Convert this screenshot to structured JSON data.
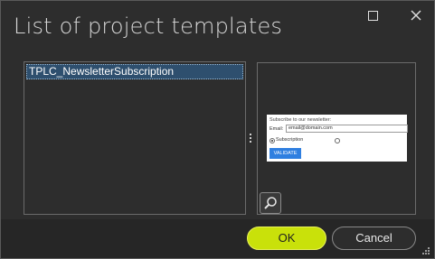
{
  "window": {
    "title": "List of project templates",
    "maximize_icon": "maximize-icon",
    "close_icon": "close-icon"
  },
  "templates": {
    "items": [
      {
        "label": "TPLC_NewsletterSubscription",
        "selected": true
      }
    ]
  },
  "preview": {
    "heading": "Subscribe to our newsletter:",
    "email_label": "Email:",
    "email_value": "email@domain.com",
    "radio_label": "Subscription",
    "validate_label": "VALIDATE",
    "zoom_icon": "magnifier-icon"
  },
  "footer": {
    "ok_label": "OK",
    "cancel_label": "Cancel",
    "resize_icon": "resize-grip-icon"
  },
  "colors": {
    "background": "#2d2d2d",
    "footer": "#262626",
    "ok_accent": "#c9e10a",
    "selection": "#2e4f6e",
    "validate_button": "#2f7fe0"
  }
}
